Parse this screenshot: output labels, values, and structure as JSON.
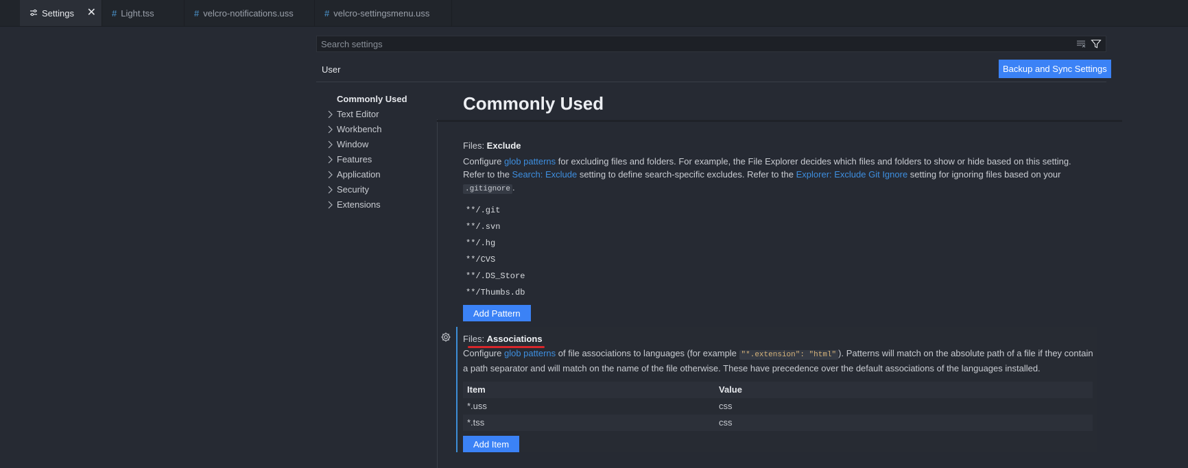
{
  "tabs": [
    {
      "label": "Settings",
      "icon": "settings-icon",
      "active": true
    },
    {
      "label": "Light.tss",
      "icon": "hash-icon"
    },
    {
      "label": "velcro-notifications.uss",
      "icon": "hash-icon"
    },
    {
      "label": "velcro-settingsmenu.uss",
      "icon": "hash-icon"
    }
  ],
  "search": {
    "placeholder": "Search settings"
  },
  "scope_tab": "User",
  "sync_button": "Backup and Sync Settings",
  "toc": [
    {
      "label": "Commonly Used",
      "selected": true
    },
    {
      "label": "Text Editor"
    },
    {
      "label": "Workbench"
    },
    {
      "label": "Window"
    },
    {
      "label": "Features"
    },
    {
      "label": "Application"
    },
    {
      "label": "Security"
    },
    {
      "label": "Extensions"
    }
  ],
  "page_title": "Commonly Used",
  "exclude": {
    "prefix": "Files: ",
    "name": "Exclude",
    "desc1": "Configure ",
    "link1": "glob patterns",
    "desc2": " for excluding files and folders. For example, the File Explorer decides which files and folders to show or hide based on this setting. Refer to the ",
    "link2": "Search: Exclude",
    "desc3": " setting to define search-specific excludes. Refer to the ",
    "link3": "Explorer: Exclude Git Ignore",
    "desc4": " setting for ignoring files based on your ",
    "code": ".gitignore",
    "desc5": ".",
    "patterns": [
      "**/.git",
      "**/.svn",
      "**/.hg",
      "**/CVS",
      "**/.DS_Store",
      "**/Thumbs.db"
    ],
    "add_button": "Add Pattern"
  },
  "associations": {
    "prefix": "Files: ",
    "name": "Associations",
    "desc1": "Configure ",
    "link1": "glob patterns",
    "desc2": " of file associations to languages (for example ",
    "code": "\"*.extension\": \"html\"",
    "desc3": "). Patterns will match on the absolute path of a file if they contain a path separator and will match on the name of the file otherwise. These have precedence over the default associations of the languages installed.",
    "col_item": "Item",
    "col_value": "Value",
    "rows": [
      {
        "item": "*.uss",
        "value": "css"
      },
      {
        "item": "*.tss",
        "value": "css"
      }
    ],
    "add_button": "Add Item"
  },
  "colors": {
    "accent": "#3b82f6",
    "link": "#3e8fe0",
    "annotation": "#d8262a"
  }
}
